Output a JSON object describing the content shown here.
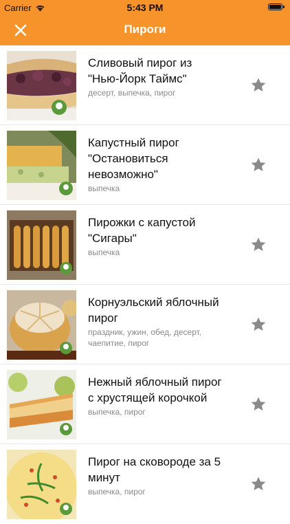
{
  "status": {
    "carrier": "Carrier",
    "time": "5:43 PM"
  },
  "nav": {
    "title": "Пироги"
  },
  "colors": {
    "accent": "#f7932b",
    "star": "#8a8a8a"
  },
  "recipes": [
    {
      "title": "Сливовый пирог из \"Нью-Йорк Таймс\"",
      "tags": "десерт, выпечка, пирог"
    },
    {
      "title": "Капустный пирог \"Остановиться невозможно\"",
      "tags": "выпечка"
    },
    {
      "title": "Пирожки с капустой \"Сигары\"",
      "tags": "выпечка"
    },
    {
      "title": "Корнуэльский яблочный пирог",
      "tags": "праздник, ужин, обед, десерт, чаепитие, пирог"
    },
    {
      "title": "Нежный яблочный пирог с хрустящей корочкой",
      "tags": "выпечка, пирог"
    },
    {
      "title": "Пирог на сковороде за 5 минут",
      "tags": "выпечка, пирог"
    }
  ]
}
